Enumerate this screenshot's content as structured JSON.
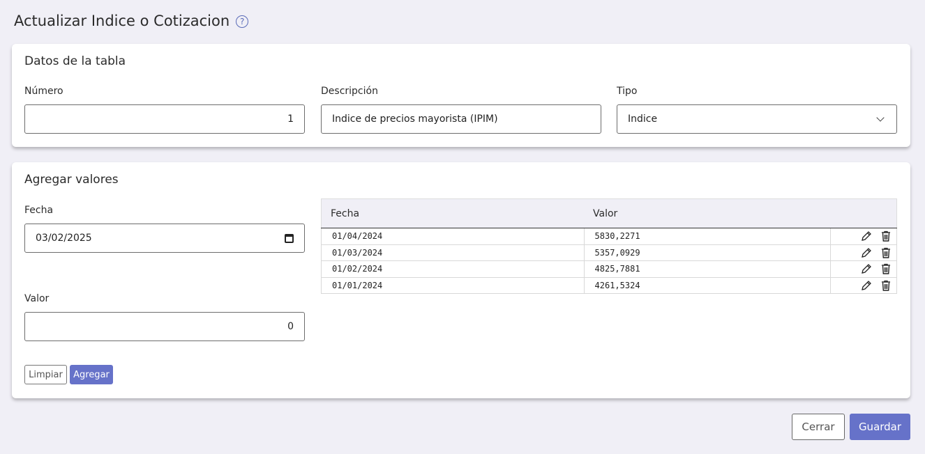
{
  "page": {
    "title": "Actualizar Indice o Cotizacion",
    "help_glyph": "?"
  },
  "datos": {
    "title": "Datos de la tabla",
    "numero_label": "Número",
    "numero_value": "1",
    "descripcion_label": "Descripción",
    "descripcion_value": "Indice de precios mayorista (IPIM)",
    "tipo_label": "Tipo",
    "tipo_value": "Indice"
  },
  "agregar": {
    "title": "Agregar valores",
    "fecha_label": "Fecha",
    "fecha_value": "03/02/2025",
    "valor_label": "Valor",
    "valor_value": "0",
    "limpiar_label": "Limpiar",
    "agregar_label": "Agregar"
  },
  "table": {
    "headers": [
      "Fecha",
      "Valor",
      ""
    ],
    "rows": [
      [
        "01/04/2024",
        "5830,2271"
      ],
      [
        "01/03/2024",
        "5357,0929"
      ],
      [
        "01/02/2024",
        "4825,7881"
      ],
      [
        "01/01/2024",
        "4261,5324"
      ]
    ]
  },
  "footer": {
    "cerrar_label": "Cerrar",
    "guardar_label": "Guardar"
  },
  "colors": {
    "primary": "#6672c9",
    "background": "#f0eff6",
    "help": "#5a6bb8"
  },
  "icons": {
    "help": "question-circle-icon",
    "edit": "pencil-icon",
    "delete": "trash-icon",
    "select": "chevron-down-icon",
    "date": "calendar-icon"
  }
}
